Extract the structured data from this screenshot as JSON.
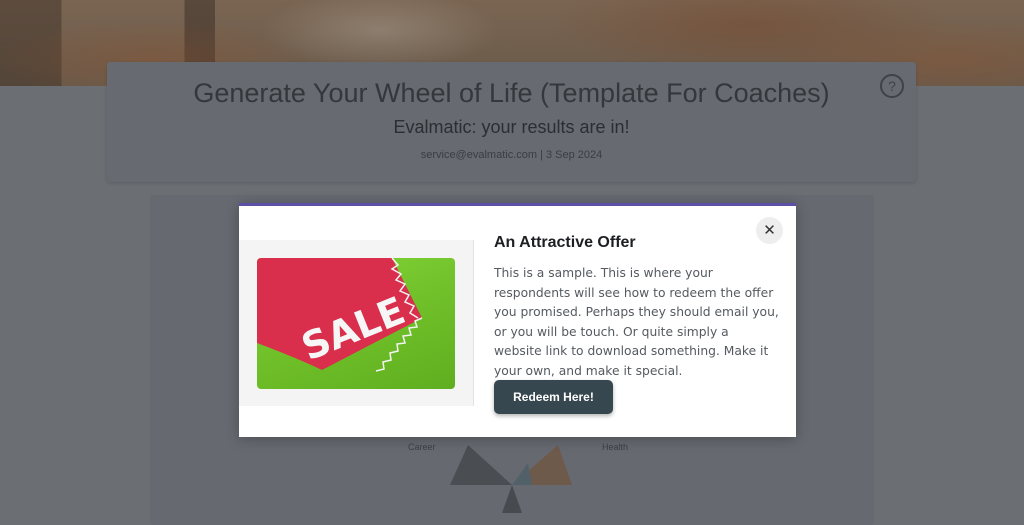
{
  "background": {
    "title": "Generate Your Wheel of Life (Template For Coaches)",
    "subtitle": "Evalmatic: your results are in!",
    "meta": "service@evalmatic.com | 3 Sep 2024",
    "help_icon": "help-circle-icon",
    "label_left": "Career",
    "label_right": "Health"
  },
  "modal": {
    "accent_color": "#5c4fa6",
    "title": "An Attractive Offer",
    "body": "This is a sample. This is where your respondents will see how to redeem the offer you promised. Perhaps they should email you, or you will be touch. Or quite simply a website link to download something. Make it your own, and make it special.",
    "image_text": "SALE",
    "close_icon": "close-icon",
    "close_symbol": "✕",
    "redeem_label": "Redeem Here!",
    "button_color": "#37474f"
  }
}
